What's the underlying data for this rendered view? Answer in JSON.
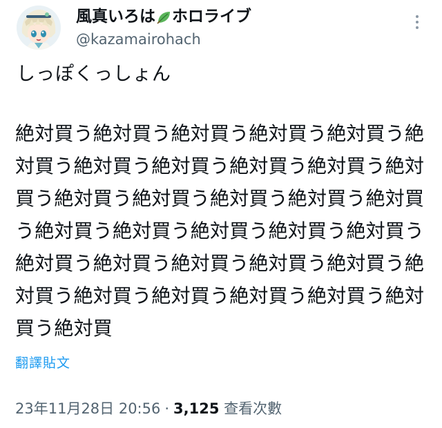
{
  "author": {
    "display_name": "風真いろは",
    "display_name_suffix": "ホロライブ",
    "leaf_icon": "leaf-emoji",
    "handle": "@kazamairohach"
  },
  "tweet": {
    "first_line": "しっぽくっしょん",
    "body_lines": [
      "絶対買う絶対買う絶対買う絶対買う絶対買う絶",
      "対買う絶対買う絶対買う絶対買う絶対買う絶対",
      "買う絶対買う絶対買う絶対買う絶対買う絶対買",
      "う絶対買う絶対買う絶対買う絶対買う絶対買う",
      "絶対買う絶対買う絶対買う絶対買う絶対買う絶",
      "対買う絶対買う絶対買う絶対買う絶対買う絶対",
      "買う絶対買"
    ],
    "translate_label": "翻譯貼文"
  },
  "meta": {
    "timestamp": "23年11月28日 20:56",
    "separator": "·",
    "views_count": "3,125",
    "views_label": "查看次數"
  },
  "colors": {
    "accent": "#1d9bf0",
    "secondary_text": "#536471",
    "primary_text": "#0f1419"
  }
}
